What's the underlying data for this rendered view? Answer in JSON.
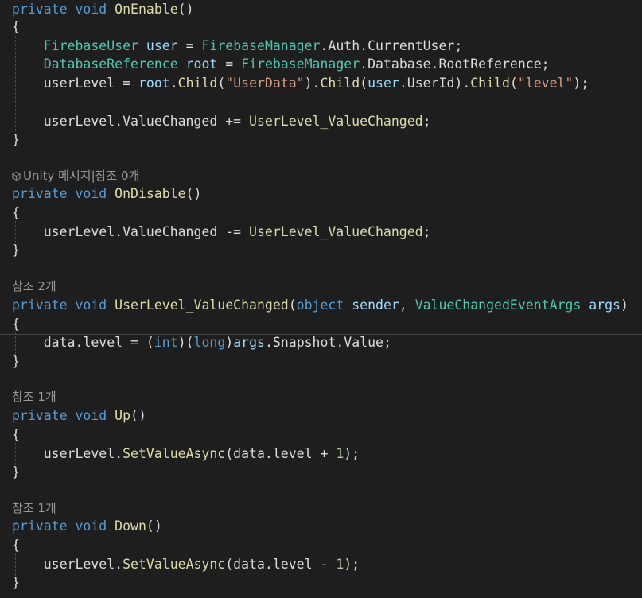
{
  "code": {
    "onenable": {
      "sig_kw1": "private",
      "sig_kw2": "void",
      "sig_name": "OnEnable",
      "sig_paren": "()",
      "open_brace": "{",
      "l1_type": "FirebaseUser",
      "l1_var": "user",
      "l1_eq": " = ",
      "l1_cls": "FirebaseManager",
      "l1_rest": ".Auth.CurrentUser;",
      "l2_type": "DatabaseReference",
      "l2_var": "root",
      "l2_eq": " = ",
      "l2_cls": "FirebaseManager",
      "l2_rest": ".Database.RootReference;",
      "l3_lhs": "userLevel = ",
      "l3_root": "root",
      "l3_dot1": ".",
      "l3_child1": "Child",
      "l3_p1": "(",
      "l3_s1": "\"UserData\"",
      "l3_p2": ").",
      "l3_child2": "Child",
      "l3_p3": "(",
      "l3_user": "user",
      "l3_uid": ".UserId).",
      "l3_child3": "Child",
      "l3_p4": "(",
      "l3_s2": "\"level\"",
      "l3_end": ");",
      "l4_lhs": "userLevel.ValueChanged += ",
      "l4_handler": "UserLevel_ValueChanged",
      "l4_end": ";",
      "close_brace": "}"
    },
    "ondisable": {
      "lens_text": "Unity 메시지|참조 0개",
      "sig_kw1": "private",
      "sig_kw2": "void",
      "sig_name": "OnDisable",
      "sig_paren": "()",
      "open_brace": "{",
      "l1_lhs": "userLevel.ValueChanged -= ",
      "l1_handler": "UserLevel_ValueChanged",
      "l1_end": ";",
      "close_brace": "}"
    },
    "valuechanged": {
      "lens_text": "참조 2개",
      "sig_kw1": "private",
      "sig_kw2": "void",
      "sig_name": "UserLevel_ValueChanged",
      "sig_p1": "(",
      "sig_kw3": "object",
      "sig_sender": "sender",
      "sig_comma": ", ",
      "sig_type": "ValueChangedEventArgs",
      "sig_args": "args",
      "sig_p2": ")",
      "open_brace": "{",
      "l1_a": "data.level = (",
      "l1_int": "int",
      "l1_b": ")(",
      "l1_long": "long",
      "l1_c": ")",
      "l1_args": "args",
      "l1_d": ".Snapshot.Value;",
      "close_brace": "}"
    },
    "up": {
      "lens_text": "참조 1개",
      "sig_kw1": "private",
      "sig_kw2": "void",
      "sig_name": "Up",
      "sig_paren": "()",
      "open_brace": "{",
      "l1_a": "userLevel.",
      "l1_fn": "SetValueAsync",
      "l1_b": "(data.level + ",
      "l1_num": "1",
      "l1_c": ");",
      "close_brace": "}"
    },
    "down": {
      "lens_text": "참조 1개",
      "sig_kw1": "private",
      "sig_kw2": "void",
      "sig_name": "Down",
      "sig_paren": "()",
      "open_brace": "{",
      "l1_a": "userLevel.",
      "l1_fn": "SetValueAsync",
      "l1_b": "(data.level - ",
      "l1_num": "1",
      "l1_c": ");",
      "close_brace": "}"
    }
  },
  "colors": {
    "background": "#1e1e1e",
    "keyword": "#569cd6",
    "method": "#dcdcaa",
    "type": "#4ec9b0",
    "variable": "#9cdcfe",
    "string": "#d69d85",
    "number": "#b5cea8",
    "codelens": "#999999"
  }
}
